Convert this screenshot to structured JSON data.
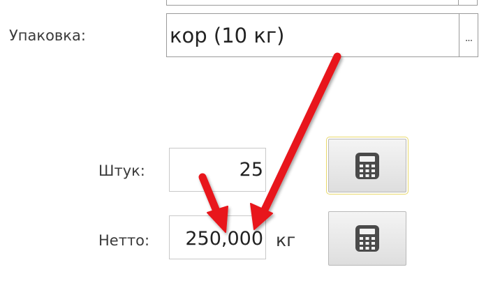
{
  "packaging": {
    "label": "Упаковка:",
    "value": "кор (10 кг)",
    "select_label": "..."
  },
  "pieces": {
    "label": "Штук:",
    "value": "25"
  },
  "net": {
    "label": "Нетто:",
    "value": "250,000",
    "unit": "кг"
  },
  "colors": {
    "annotation_arrow": "#e8141a",
    "field_border": "#9a9a9a",
    "button_focus_border": "#e8d86a"
  },
  "icons": {
    "calc_button_1": "calculator-icon",
    "calc_button_2": "calculator-icon"
  }
}
